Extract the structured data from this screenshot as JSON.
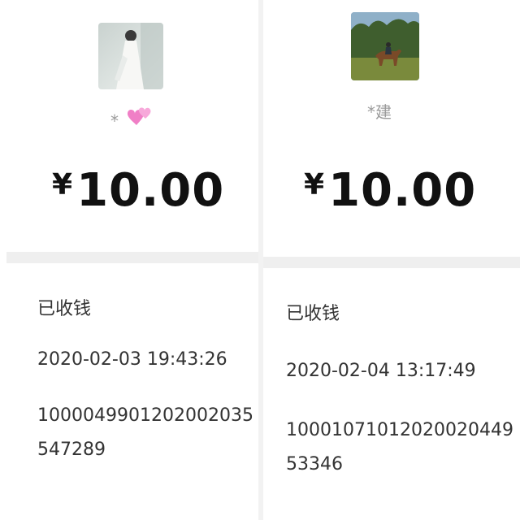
{
  "left": {
    "name": "*",
    "amount": "10.00",
    "currency": "¥",
    "status": "已收钱",
    "time": "2020-02-03 19:43:26",
    "transaction_id": "1000049901202002035547289"
  },
  "right": {
    "name": "*建",
    "amount": "10.00",
    "currency": "¥",
    "status": "已收钱",
    "time": "2020-02-04 13:17:49",
    "transaction_id": "1000107101202002044953346"
  }
}
